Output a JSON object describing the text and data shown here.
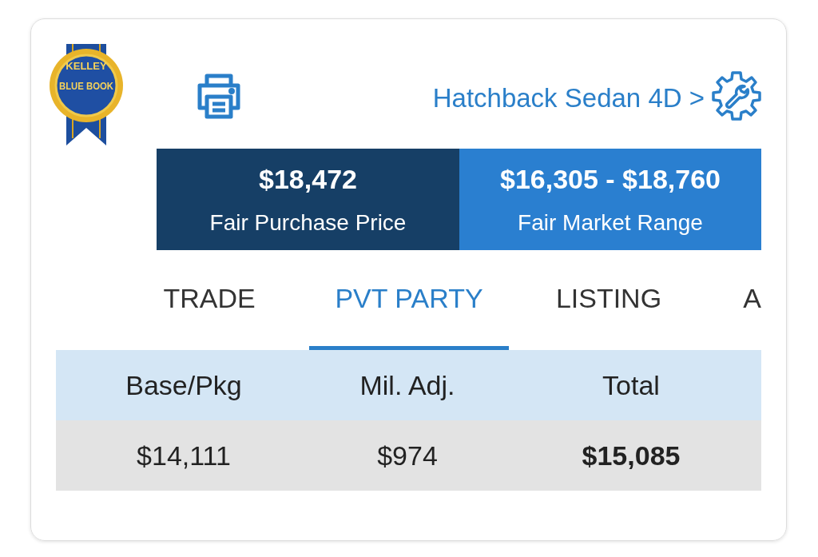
{
  "logo": {
    "top_text": "KELLEY",
    "main_text": "BLUE BOOK"
  },
  "header": {
    "trim": "Hatchback Sedan 4D",
    "chevron": ">"
  },
  "prices": [
    {
      "kind": "purchase",
      "value": "$18,472",
      "label": "Fair Purchase Price"
    },
    {
      "kind": "range",
      "value": "$16,305 - $18,760",
      "label": "Fair Market Range"
    }
  ],
  "tabs": [
    {
      "label": "TRADE",
      "selected": false
    },
    {
      "label": "PVT PARTY",
      "selected": true
    },
    {
      "label": "LISTING",
      "selected": false
    },
    {
      "label": "A",
      "selected": false
    }
  ],
  "table": {
    "columns": [
      "Base/Pkg",
      "Mil. Adj.",
      "Total"
    ],
    "rows": [
      {
        "cells": [
          "$14,111",
          "$974",
          "$15,085"
        ]
      }
    ]
  }
}
